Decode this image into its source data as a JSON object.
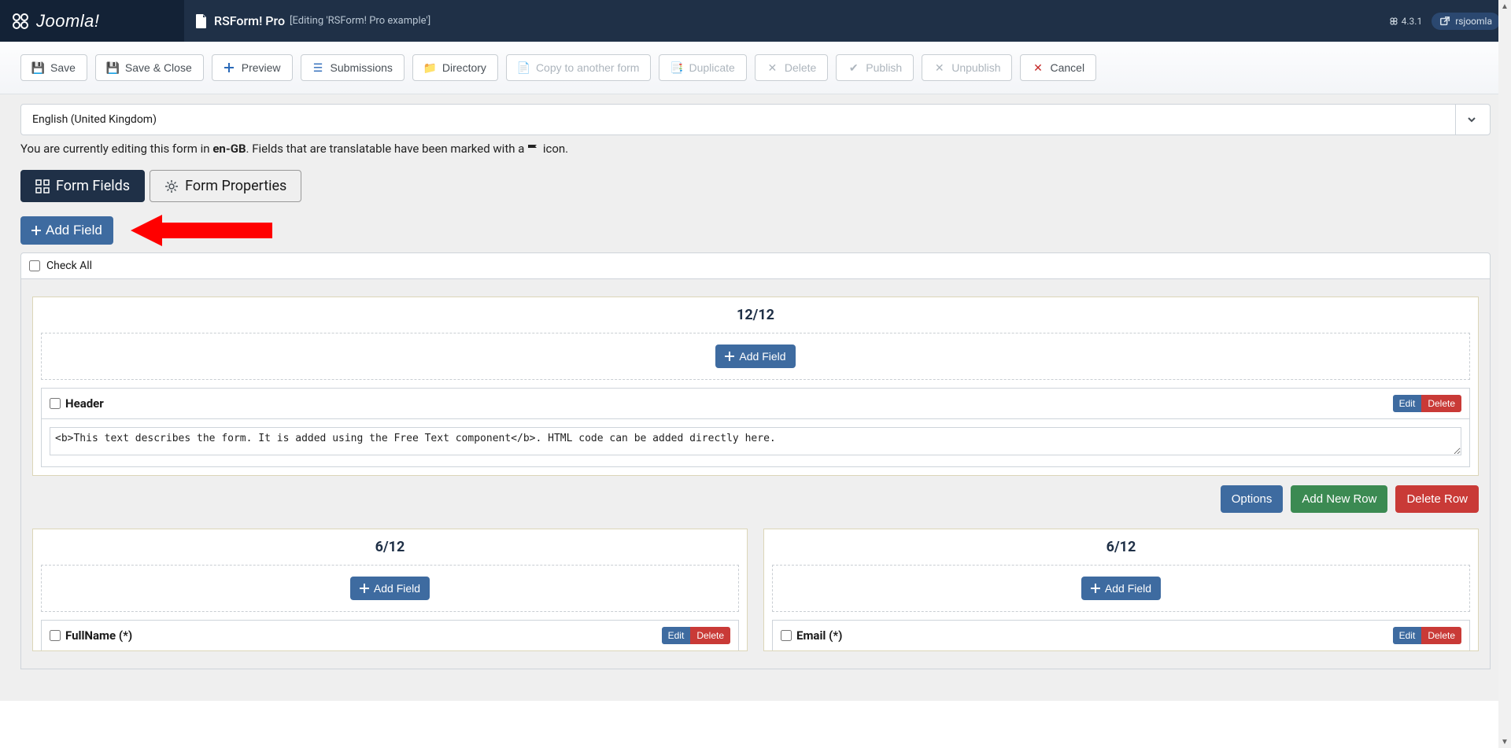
{
  "topbar": {
    "brand": "Joomla!",
    "title": "RSForm! Pro",
    "subtitle": "[Editing 'RSForm! Pro example']",
    "version": "4.3.1",
    "user": "rsjoomla"
  },
  "toolbar": {
    "save": "Save",
    "save_close": "Save & Close",
    "preview": "Preview",
    "submissions": "Submissions",
    "directory": "Directory",
    "copy": "Copy to another form",
    "duplicate": "Duplicate",
    "delete": "Delete",
    "publish": "Publish",
    "unpublish": "Unpublish",
    "cancel": "Cancel"
  },
  "language": {
    "selected": "English (United Kingdom)",
    "note_prefix": "You are currently editing this form in ",
    "note_lang": "en-GB",
    "note_suffix": ". Fields that are translatable have been marked with a ",
    "note_tail": " icon."
  },
  "tabs": {
    "form_fields": "Form Fields",
    "form_properties": "Form Properties"
  },
  "buttons": {
    "add_field": "Add Field",
    "check_all": "Check All",
    "inner_add_field": "Add Field",
    "edit": "Edit",
    "delete": "Delete",
    "options": "Options",
    "add_new_row": "Add New Row",
    "delete_row": "Delete Row"
  },
  "rows": [
    {
      "title": "12/12",
      "fields": [
        {
          "name": "Header",
          "body": "<b>This text describes the form. It is added using the Free Text component</b>. HTML code can be added directly here."
        }
      ]
    }
  ],
  "cols": [
    {
      "title": "6/12",
      "field_name": "FullName (*)"
    },
    {
      "title": "6/12",
      "field_name": "Email (*)"
    }
  ]
}
